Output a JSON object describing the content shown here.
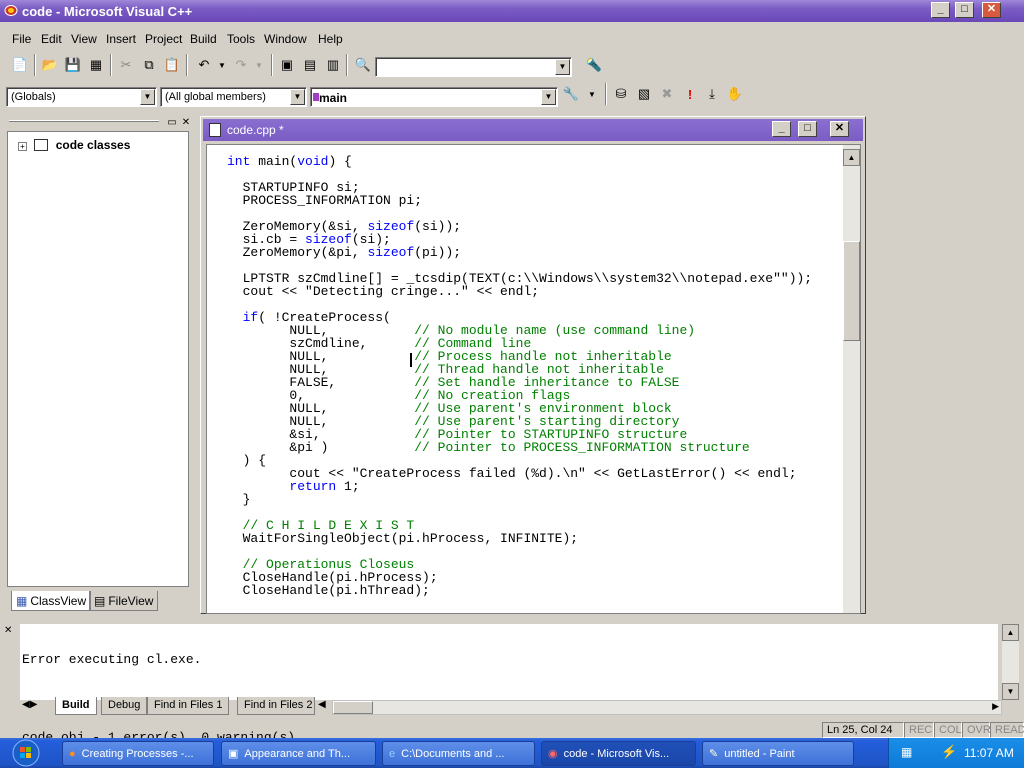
{
  "app_title": "code - Microsoft Visual C++",
  "window_buttons": {
    "minimize": "_",
    "maximize": "□",
    "close": "✕"
  },
  "menu": [
    {
      "label": "File"
    },
    {
      "label": "Edit"
    },
    {
      "label": "View"
    },
    {
      "label": "Insert"
    },
    {
      "label": "Project"
    },
    {
      "label": "Build"
    },
    {
      "label": "Tools"
    },
    {
      "label": "Window"
    },
    {
      "label": "Help"
    }
  ],
  "wizard_bar": {
    "scope": "(Globals)",
    "members": "(All global members)",
    "function": "main"
  },
  "classview": {
    "root": "code classes",
    "tabs": [
      "ClassView",
      "FileView"
    ]
  },
  "editor": {
    "title": "code.cpp *"
  },
  "code_lines": [
    "int main(void) {",
    "",
    "  STARTUPINFO si;",
    "  PROCESS_INFORMATION pi;",
    "",
    "  ZeroMemory(&si, sizeof(si));",
    "  si.cb = sizeof(si);",
    "  ZeroMemory(&pi, sizeof(pi));",
    "",
    "  LPTSTR szCmdline[] = _tcsdip(TEXT(c:\\\\Windows\\\\system32\\\\notepad.exe\"\"));",
    "  cout << \"Detecting cringe...\" << endl;",
    "",
    "  if( !CreateProcess(",
    "        NULL,           // No module name (use command line)",
    "        szCmdline,      // Command line",
    "        NULL,           // Process handle not inheritable",
    "        NULL,           // Thread handle not inheritable",
    "        FALSE,          // Set handle inheritance to FALSE",
    "        0,              // No creation flags",
    "        NULL,           // Use parent's environment block",
    "        NULL,           // Use parent's starting directory",
    "        &si,            // Pointer to STARTUPINFO structure",
    "        &pi )           // Pointer to PROCESS_INFORMATION structure",
    "  ) {",
    "        cout << \"CreateProcess failed (%d).\\n\" << GetLastError() << endl;",
    "        return 1;",
    "  }",
    "",
    "  // C H I L D E X I S T",
    "  WaitForSingleObject(pi.hProcess, INFINITE);",
    "",
    "  // Operationus Closeus",
    "  CloseHandle(pi.hProcess);",
    "  CloseHandle(pi.hThread);"
  ],
  "output": {
    "lines": [
      "Error executing cl.exe.",
      "",
      "code.obj - 1 error(s), 0 warning(s)"
    ],
    "tabs": [
      "Build",
      "Debug",
      "Find in Files 1",
      "Find in Files 2"
    ]
  },
  "status": {
    "position": "Ln 25, Col 24",
    "rec": "REC",
    "col": "COL",
    "ovr": "OVR",
    "read": "READ"
  },
  "taskbar": {
    "items": [
      "Creating Processes -...",
      "Appearance and Th...",
      "C:\\Documents and ...",
      "code - Microsoft Vis...",
      "untitled - Paint"
    ],
    "clock": "11:07 AM"
  }
}
